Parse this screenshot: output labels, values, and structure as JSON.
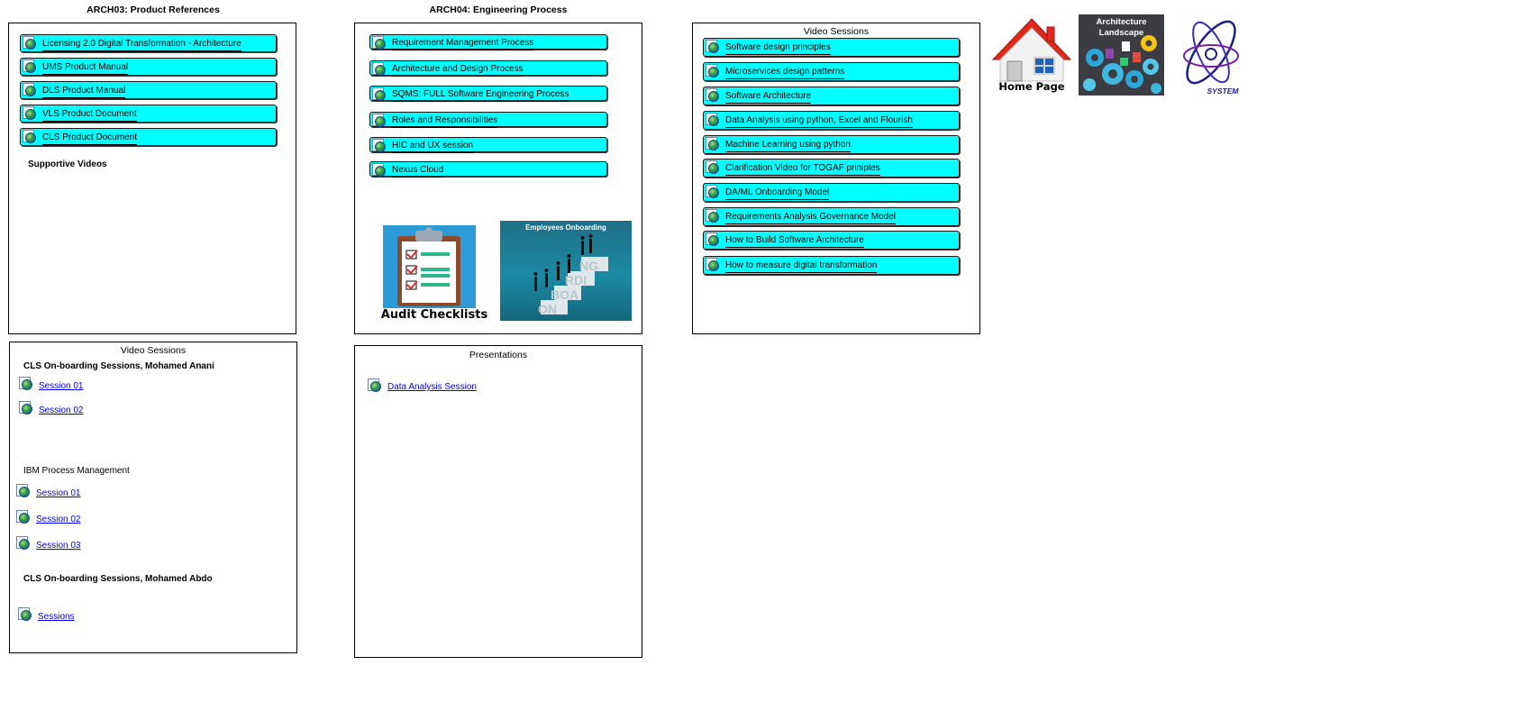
{
  "arch03": {
    "heading": "ARCH03: Product References",
    "links": [
      "Licensing 2.0 Digital Transformation - Architecture",
      "UMS Product Manual",
      "DLS Product Manual",
      "VLS Product Document",
      "CLS Product Document"
    ],
    "supportive_label": "Supportive Videos"
  },
  "arch04": {
    "heading": "ARCH04: Engineering Process",
    "links": [
      "Requirement Management Process",
      "Architecture and Design Process",
      "SQMS: FULL Software Engineering Process",
      "Roles and Responsibilities",
      "HIC and UX session",
      "Nexus Cloud"
    ],
    "audit_image_caption": "Audit Checklists",
    "onboarding_image_title": "Employees Onboarding",
    "onboarding_steps": [
      "NG",
      "RDI",
      "BOA",
      "ON"
    ]
  },
  "video_sessions_right": {
    "title": "Video Sessions",
    "links": [
      "Software design principles",
      "Microservices design patterns",
      "Software Architecture",
      "Data Analysis using python, Excel and Flourish",
      "Machine Learning using python",
      "Clarification Video for TOGAF priniples",
      "DA/ML Onboarding Model",
      "Requirements Analysis Governance Model",
      "How to Build Software Architecture",
      "How to measure digital transformation"
    ]
  },
  "video_sessions_left": {
    "title": "Video Sessions",
    "group1_title": "CLS On-boarding Sessions, Mohamed Anani",
    "group1_links": [
      "Session 01",
      "Session 02"
    ],
    "group2_title": "IBM Process Management",
    "group2_links": [
      "Session 01",
      "Session 02",
      "Session 03"
    ],
    "group3_title": "CLS On-boarding Sessions, Mohamed Abdo",
    "group3_links": [
      "Sessions"
    ]
  },
  "presentations": {
    "title": "Presentations",
    "links": [
      "Data Analysis Session"
    ]
  },
  "nav": {
    "home_label": "Home Page",
    "landscape_label": "Architecture Landscape",
    "journey_label": "SYSTEM JOURNEY"
  },
  "colors": {
    "link_button_bg": "#00ffff",
    "hyperlink": "#0000ee"
  }
}
